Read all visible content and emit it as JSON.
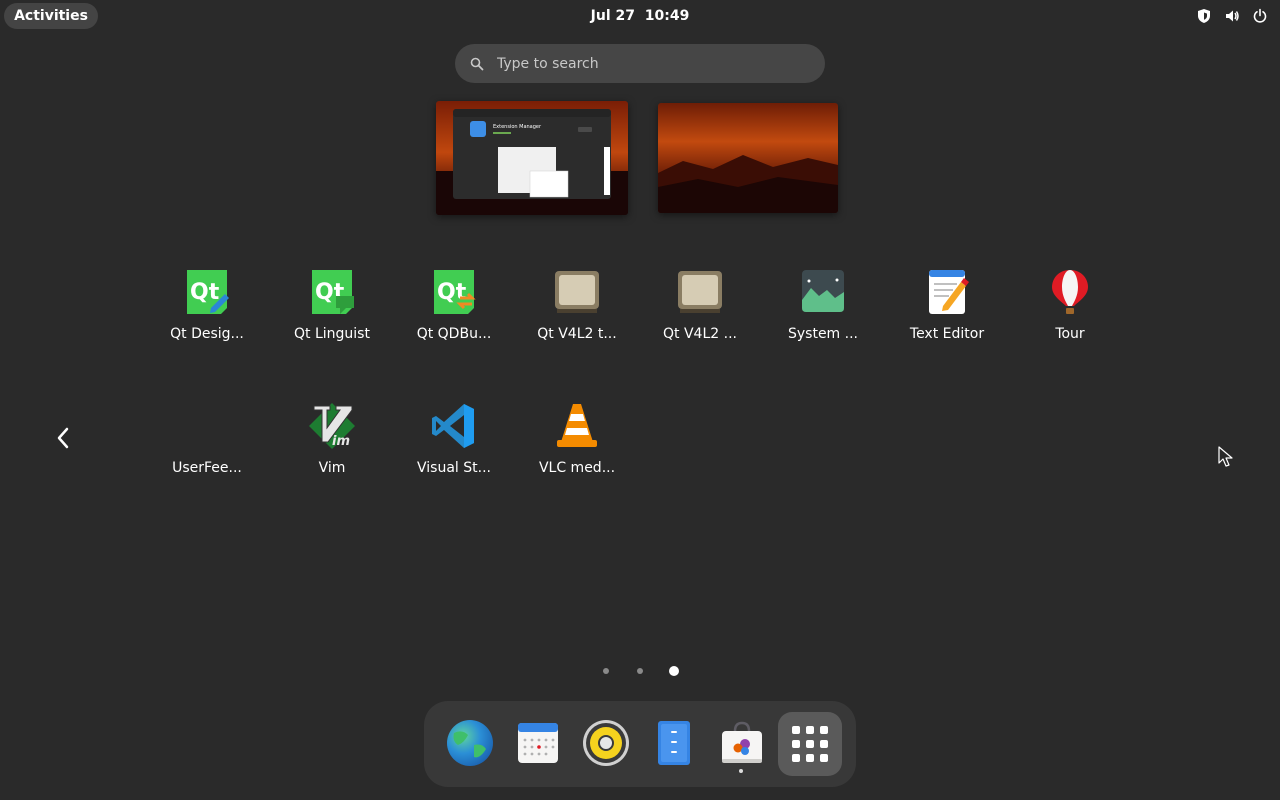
{
  "topbar": {
    "activities_label": "Activities",
    "date": "Jul 27",
    "time": "10:49",
    "status_icons": [
      "shield-icon",
      "volume-icon",
      "power-icon"
    ]
  },
  "search": {
    "placeholder": "Type to search",
    "icon": "search-icon"
  },
  "workspaces": [
    {
      "window_title": "Extension Manager"
    },
    {}
  ],
  "app_grid": {
    "apps": [
      {
        "label": "Qt Desig...",
        "icon": "qt-designer-icon"
      },
      {
        "label": "Qt Linguist",
        "icon": "qt-linguist-icon"
      },
      {
        "label": "Qt QDBu...",
        "icon": "qt-qdbusviewer-icon"
      },
      {
        "label": "Qt V4L2 t...",
        "icon": "qt-v4l2-test-icon"
      },
      {
        "label": "Qt V4L2 ...",
        "icon": "qt-v4l2-icon"
      },
      {
        "label": "System ...",
        "icon": "system-monitor-icon"
      },
      {
        "label": "Text Editor",
        "icon": "text-editor-icon"
      },
      {
        "label": "Tour",
        "icon": "tour-balloon-icon"
      },
      {
        "label": "UserFee...",
        "icon": "userfeedback-icon"
      },
      {
        "label": "Vim",
        "icon": "vim-icon"
      },
      {
        "label": "Visual St...",
        "icon": "vscode-icon"
      },
      {
        "label": "VLC med...",
        "icon": "vlc-icon"
      }
    ],
    "page_count": 3,
    "current_page": 3
  },
  "dock": {
    "items": [
      {
        "name": "Web Browser",
        "icon": "globe-icon"
      },
      {
        "name": "Calendar",
        "icon": "calendar-icon"
      },
      {
        "name": "Rhythmbox",
        "icon": "speaker-icon"
      },
      {
        "name": "Files",
        "icon": "files-icon"
      },
      {
        "name": "Software",
        "icon": "software-bag-icon",
        "running": true
      },
      {
        "name": "Show Apps",
        "icon": "app-grid-icon"
      }
    ]
  },
  "colors": {
    "background": "#2a2a2a",
    "search_bg": "#464646",
    "dock_bg": "#383838",
    "activities_bg": "#444444"
  }
}
